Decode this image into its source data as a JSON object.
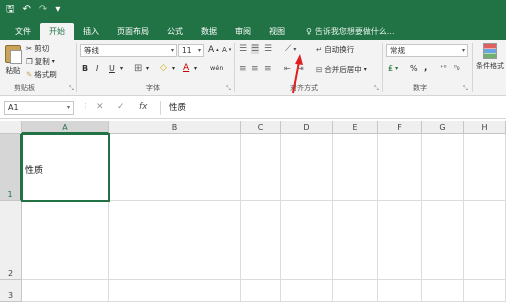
{
  "titlebar": {
    "save": "🖫",
    "undo": "↶",
    "redo": "↷",
    "customize": "▾"
  },
  "tabs": [
    {
      "label": "文件"
    },
    {
      "label": "开始",
      "active": true
    },
    {
      "label": "插入"
    },
    {
      "label": "页面布局"
    },
    {
      "label": "公式"
    },
    {
      "label": "数据"
    },
    {
      "label": "审阅"
    },
    {
      "label": "视图"
    }
  ],
  "tell_me": "告诉我您想要做什么...",
  "ribbon": {
    "clipboard": {
      "paste": "粘贴",
      "cut": "剪切",
      "copy": "复制",
      "format_painter": "格式刷",
      "label": "剪贴板"
    },
    "font": {
      "name": "等线",
      "size": "11",
      "grow": "A",
      "shrink": "A",
      "bold": "B",
      "italic": "I",
      "underline": "U",
      "border": "⊞",
      "fill": "◇",
      "color": "A",
      "phonetic": "wén",
      "label": "字体"
    },
    "alignment": {
      "wrap": "自动换行",
      "merge": "合并后居中",
      "label": "对齐方式"
    },
    "number": {
      "format": "常规",
      "currency": "₤",
      "percent": "%",
      "comma": ",",
      "inc": "⁺⁰",
      "dec": "⁰₀",
      "label": "数字"
    },
    "styles": {
      "conditional": "条件格式"
    }
  },
  "formula_bar": {
    "name_box": "A1",
    "cancel": "✕",
    "enter": "✓",
    "fx": "fx",
    "content": "性质"
  },
  "grid": {
    "columns": [
      "A",
      "B",
      "C",
      "D",
      "E",
      "F",
      "G",
      "H"
    ],
    "rows": [
      "1",
      "2",
      "3"
    ],
    "cells": {
      "A1": "性质"
    }
  },
  "colors": {
    "accent": "#217346",
    "annotation": "#e02020"
  }
}
